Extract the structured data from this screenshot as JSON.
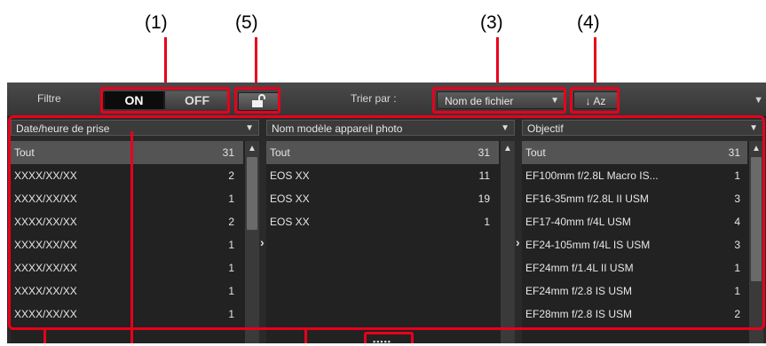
{
  "callouts": [
    "(1)",
    "(5)",
    "(3)",
    "(4)"
  ],
  "toolbar": {
    "filter_label": "Filtre",
    "on_label": "ON",
    "off_label": "OFF",
    "lock_icon": "unlocked-padlock-icon",
    "sort_label": "Trier par :",
    "sort_value": "Nom de fichier",
    "sort_order_label": "↓ Aᴢ",
    "collapse_icon": "triangle-down-icon"
  },
  "columns": [
    {
      "header": "Date/heure de prise",
      "rows": [
        {
          "label": "Tout",
          "count": "31"
        },
        {
          "label": "XXXX/XX/XX",
          "count": "2"
        },
        {
          "label": "XXXX/XX/XX",
          "count": "1"
        },
        {
          "label": "XXXX/XX/XX",
          "count": "2"
        },
        {
          "label": "XXXX/XX/XX",
          "count": "1"
        },
        {
          "label": "XXXX/XX/XX",
          "count": "1"
        },
        {
          "label": "XXXX/XX/XX",
          "count": "1"
        },
        {
          "label": "XXXX/XX/XX",
          "count": "1"
        }
      ]
    },
    {
      "header": "Nom modèle appareil photo",
      "rows": [
        {
          "label": "Tout",
          "count": "31"
        },
        {
          "label": "EOS XX",
          "count": "11"
        },
        {
          "label": "EOS XX",
          "count": "19"
        },
        {
          "label": "EOS XX",
          "count": "1"
        }
      ]
    },
    {
      "header": "Objectif",
      "rows": [
        {
          "label": "Tout",
          "count": "31"
        },
        {
          "label": "EF100mm f/2.8L Macro IS...",
          "count": "1"
        },
        {
          "label": "EF16-35mm f/2.8L II USM",
          "count": "3"
        },
        {
          "label": "EF17-40mm f/4L USM",
          "count": "4"
        },
        {
          "label": "EF24-105mm f/4L IS USM",
          "count": "3"
        },
        {
          "label": "EF24mm f/1.4L II USM",
          "count": "1"
        },
        {
          "label": "EF24mm f/2.8 IS USM",
          "count": "1"
        },
        {
          "label": "EF28mm f/2.8 IS USM",
          "count": "2"
        }
      ]
    }
  ],
  "resize_grip_label": "▪▪▪▪▪",
  "colors": {
    "annotation": "#e8001c",
    "panel": "#2a2a2a",
    "selected_row": "#545454"
  }
}
